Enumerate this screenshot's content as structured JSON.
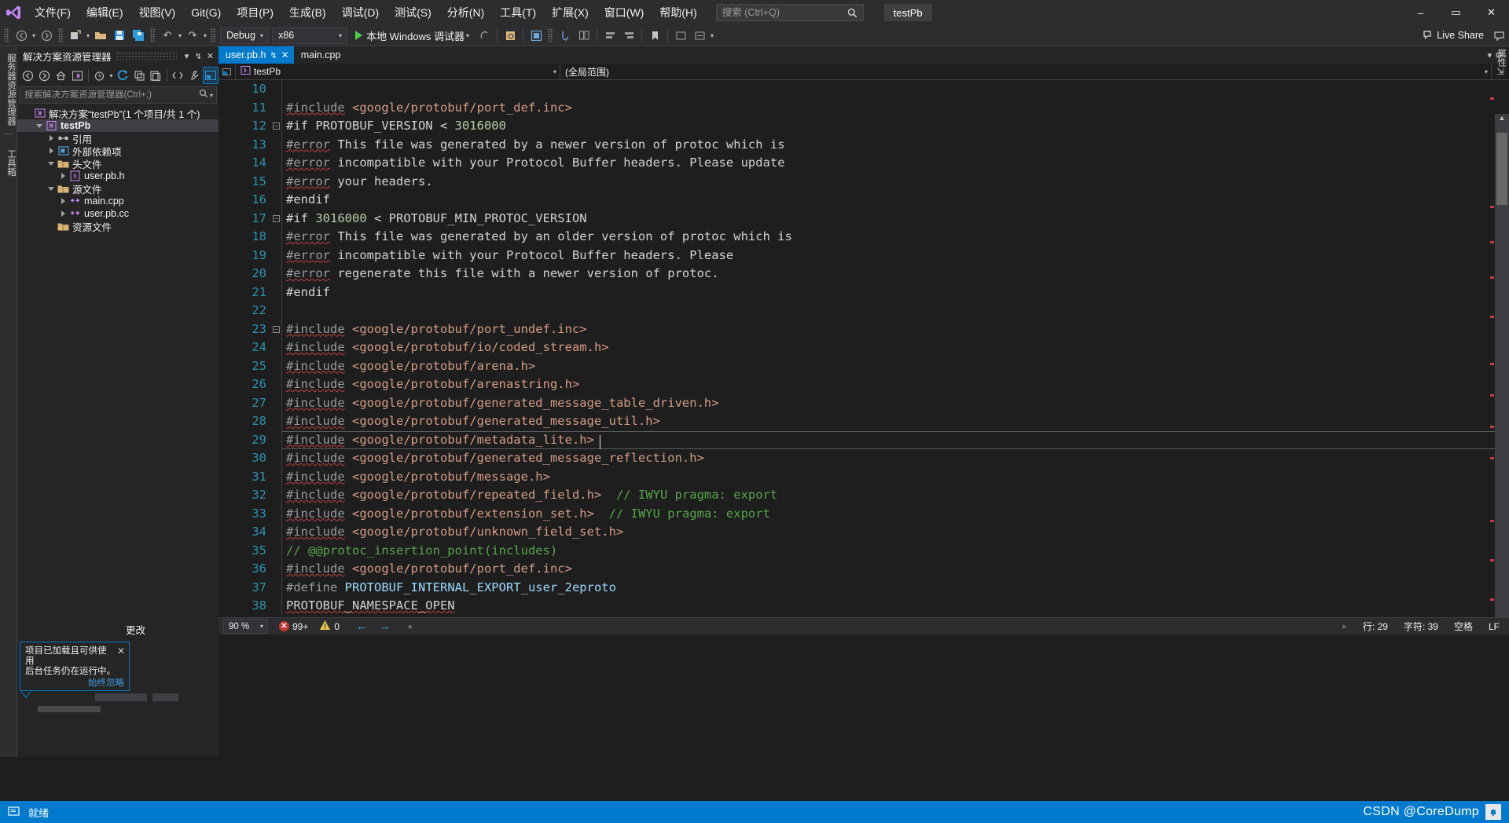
{
  "window": {
    "title": "testPb",
    "minimize": "–",
    "maximize": "▭",
    "close": "✕"
  },
  "menu": {
    "logo": "vs-logo-icon",
    "items": [
      {
        "label": "文件(F)"
      },
      {
        "label": "编辑(E)"
      },
      {
        "label": "视图(V)"
      },
      {
        "label": "Git(G)"
      },
      {
        "label": "项目(P)"
      },
      {
        "label": "生成(B)"
      },
      {
        "label": "调试(D)"
      },
      {
        "label": "测试(S)"
      },
      {
        "label": "分析(N)"
      },
      {
        "label": "工具(T)"
      },
      {
        "label": "扩展(X)"
      },
      {
        "label": "窗口(W)"
      },
      {
        "label": "帮助(H)"
      }
    ]
  },
  "search": {
    "placeholder": "搜索 (Ctrl+Q)",
    "value": ""
  },
  "toolbar": {
    "back_icon": "←",
    "forward_icon": "→",
    "new_project_icon": "new-project-icon",
    "open_icon": "open-folder-icon",
    "save_icon": "save-icon",
    "save_all_icon": "save-all-icon",
    "undo_icon": "↶",
    "redo_icon": "↷",
    "config": "Debug",
    "platform": "x86",
    "run_label": "本地 Windows 调试器",
    "caret": "▾",
    "live_share": "Live Share"
  },
  "vdock": {
    "server_explorer": "服务器资源管理器",
    "toolbox": "工具箱",
    "properties": "属性"
  },
  "solution_explorer": {
    "title": "解决方案资源管理器",
    "dropdown_icon": "▾",
    "pin_icon": "↯",
    "close_icon": "✕",
    "toolbar": [
      {
        "name": "back-icon",
        "glyph": "←"
      },
      {
        "name": "forward-icon",
        "glyph": "→"
      },
      {
        "name": "home-icon",
        "glyph": "⌂"
      },
      {
        "name": "solution-icon",
        "glyph": "▣"
      },
      {
        "name": "pending-changes-icon",
        "glyph": "◔"
      },
      {
        "name": "refresh-icon",
        "glyph": "⟳"
      },
      {
        "name": "collapse-all-icon",
        "glyph": "❐"
      },
      {
        "name": "properties-window-icon",
        "glyph": "☰"
      },
      {
        "name": "show-all-files-icon",
        "glyph": "<>"
      },
      {
        "name": "view-code-icon",
        "glyph": "🔧"
      },
      {
        "name": "preview-selected-icon",
        "glyph": "▤"
      }
    ],
    "search_placeholder": "搜索解决方案资源管理器(Ctrl+;)",
    "tree": [
      {
        "label": "解决方案“testPb”(1 个项目/共 1 个)",
        "depth": 0,
        "expander": "none",
        "icon": "solution-icon",
        "icon_color": "#c586f0",
        "selected": false,
        "bold": false
      },
      {
        "label": "testPb",
        "depth": 1,
        "expander": "down",
        "icon": "project-icon",
        "icon_color": "#c586f0",
        "selected": true,
        "bold": true
      },
      {
        "label": "引用",
        "depth": 2,
        "expander": "right",
        "icon": "references-icon",
        "icon_color": "#c8c8c8",
        "selected": false,
        "bold": false
      },
      {
        "label": "外部依赖项",
        "depth": 2,
        "expander": "right",
        "icon": "external-deps-icon",
        "icon_color": "#4ea1d3",
        "selected": false,
        "bold": false
      },
      {
        "label": "头文件",
        "depth": 2,
        "expander": "down",
        "icon": "folder-icon",
        "icon_color": "#dcb67a",
        "selected": false,
        "bold": false
      },
      {
        "label": "user.pb.h",
        "depth": 3,
        "expander": "right",
        "icon": "header-file-icon",
        "icon_color": "#c586f0",
        "selected": false,
        "bold": false
      },
      {
        "label": "源文件",
        "depth": 2,
        "expander": "down",
        "icon": "folder-icon",
        "icon_color": "#dcb67a",
        "selected": false,
        "bold": false
      },
      {
        "label": "main.cpp",
        "depth": 3,
        "expander": "right",
        "icon": "cpp-file-icon",
        "icon_color": "#c586f0",
        "selected": false,
        "bold": false
      },
      {
        "label": "user.pb.cc",
        "depth": 3,
        "expander": "right",
        "icon": "cpp-file-icon",
        "icon_color": "#c586f0",
        "selected": false,
        "bold": false
      },
      {
        "label": "资源文件",
        "depth": 2,
        "expander": "none",
        "icon": "folder-icon",
        "icon_color": "#dcb67a",
        "selected": false,
        "bold": false
      }
    ]
  },
  "notification": {
    "title": "项目已加载且可供使用",
    "subtitle": "后台任务仍在运行中。",
    "link": "始终忽略",
    "close": "✕",
    "side_text": "更改"
  },
  "editor": {
    "tabs": [
      {
        "label": "user.pb.h",
        "active": true,
        "pin": "↯",
        "close": "✕"
      },
      {
        "label": "main.cpp",
        "active": false,
        "pin": "",
        "close": ""
      }
    ],
    "tabstrip_right": {
      "dropdown": "▾",
      "settings": "⚙"
    },
    "navbar": {
      "project": "testPb",
      "scope": "(全局范围)",
      "caret": "▾",
      "split_icon": "split-view-icon",
      "maximize_icon": "⇲"
    },
    "status": {
      "zoom": "90 %",
      "zoom_caret": "▾",
      "errors": "99+",
      "warnings": "0",
      "prev_icon": "←",
      "next_icon": "→",
      "line_label": "行: 29",
      "char_label": "字符: 39",
      "indent": "空格",
      "eol": "LF"
    },
    "code_lines": [
      {
        "num": 10,
        "fold": "",
        "tokens": []
      },
      {
        "num": 11,
        "fold": "",
        "tokens": [
          {
            "t": "#include",
            "c": "k-pp",
            "squig": true
          },
          {
            "t": " ",
            "c": "k-txt"
          },
          {
            "t": "<google/protobuf/port_def.inc>",
            "c": "k-str"
          }
        ]
      },
      {
        "num": 12,
        "fold": "minus",
        "tokens": [
          {
            "t": "#if",
            "c": "k-dir"
          },
          {
            "t": " PROTOBUF_VERSION < ",
            "c": "k-txt"
          },
          {
            "t": "3016000",
            "c": "k-num"
          }
        ]
      },
      {
        "num": 13,
        "fold": "",
        "tokens": [
          {
            "t": "#error",
            "c": "k-pp",
            "squig": true
          },
          {
            "t": " This file was generated by a newer version of protoc which is",
            "c": "k-txt"
          }
        ]
      },
      {
        "num": 14,
        "fold": "",
        "tokens": [
          {
            "t": "#error",
            "c": "k-pp",
            "squig": true
          },
          {
            "t": " incompatible with your Protocol Buffer headers. Please update",
            "c": "k-txt"
          }
        ]
      },
      {
        "num": 15,
        "fold": "",
        "tokens": [
          {
            "t": "#error",
            "c": "k-pp",
            "squig": true
          },
          {
            "t": " your headers.",
            "c": "k-txt"
          }
        ]
      },
      {
        "num": 16,
        "fold": "",
        "tokens": [
          {
            "t": "#endif",
            "c": "k-dir"
          }
        ]
      },
      {
        "num": 17,
        "fold": "minus",
        "tokens": [
          {
            "t": "#if",
            "c": "k-dir"
          },
          {
            "t": " ",
            "c": "k-txt"
          },
          {
            "t": "3016000",
            "c": "k-num"
          },
          {
            "t": " < PROTOBUF_MIN_PROTOC_VERSION",
            "c": "k-txt"
          }
        ]
      },
      {
        "num": 18,
        "fold": "",
        "tokens": [
          {
            "t": "#error",
            "c": "k-pp",
            "squig": true
          },
          {
            "t": " This file was generated by an older version of protoc which is",
            "c": "k-txt"
          }
        ]
      },
      {
        "num": 19,
        "fold": "",
        "tokens": [
          {
            "t": "#error",
            "c": "k-pp",
            "squig": true
          },
          {
            "t": " incompatible with your Protocol Buffer headers. Please",
            "c": "k-txt"
          }
        ]
      },
      {
        "num": 20,
        "fold": "",
        "tokens": [
          {
            "t": "#error",
            "c": "k-pp",
            "squig": true
          },
          {
            "t": " regenerate this file with a newer version of protoc.",
            "c": "k-txt"
          }
        ]
      },
      {
        "num": 21,
        "fold": "",
        "tokens": [
          {
            "t": "#endif",
            "c": "k-dir"
          }
        ]
      },
      {
        "num": 22,
        "fold": "",
        "tokens": []
      },
      {
        "num": 23,
        "fold": "minus",
        "tokens": [
          {
            "t": "#include",
            "c": "k-pp",
            "squig": true
          },
          {
            "t": " ",
            "c": "k-txt"
          },
          {
            "t": "<google/protobuf/port_undef.inc>",
            "c": "k-str"
          }
        ]
      },
      {
        "num": 24,
        "fold": "",
        "tokens": [
          {
            "t": "#include",
            "c": "k-pp",
            "squig": true
          },
          {
            "t": " ",
            "c": "k-txt"
          },
          {
            "t": "<google/protobuf/io/coded_stream.h>",
            "c": "k-str"
          }
        ]
      },
      {
        "num": 25,
        "fold": "",
        "tokens": [
          {
            "t": "#include",
            "c": "k-pp",
            "squig": true
          },
          {
            "t": " ",
            "c": "k-txt"
          },
          {
            "t": "<google/protobuf/arena.h>",
            "c": "k-str"
          }
        ]
      },
      {
        "num": 26,
        "fold": "",
        "tokens": [
          {
            "t": "#include",
            "c": "k-pp",
            "squig": true
          },
          {
            "t": " ",
            "c": "k-txt"
          },
          {
            "t": "<google/protobuf/arenastring.h>",
            "c": "k-str"
          }
        ]
      },
      {
        "num": 27,
        "fold": "",
        "tokens": [
          {
            "t": "#include",
            "c": "k-pp",
            "squig": true
          },
          {
            "t": " ",
            "c": "k-txt"
          },
          {
            "t": "<google/protobuf/generated_message_table_driven.h>",
            "c": "k-str"
          }
        ]
      },
      {
        "num": 28,
        "fold": "",
        "tokens": [
          {
            "t": "#include",
            "c": "k-pp",
            "squig": true
          },
          {
            "t": " ",
            "c": "k-txt"
          },
          {
            "t": "<google/protobuf/generated_message_util.h>",
            "c": "k-str"
          }
        ]
      },
      {
        "num": 29,
        "fold": "",
        "current": true,
        "tokens": [
          {
            "t": "#include",
            "c": "k-pp",
            "squig": true
          },
          {
            "t": " ",
            "c": "k-txt"
          },
          {
            "t": "<google/protobuf/metadata_lite.h>",
            "c": "k-str"
          }
        ]
      },
      {
        "num": 30,
        "fold": "",
        "tokens": [
          {
            "t": "#include",
            "c": "k-pp",
            "squig": true
          },
          {
            "t": " ",
            "c": "k-txt"
          },
          {
            "t": "<google/protobuf/generated_message_reflection.h>",
            "c": "k-str"
          }
        ]
      },
      {
        "num": 31,
        "fold": "",
        "tokens": [
          {
            "t": "#include",
            "c": "k-pp",
            "squig": true
          },
          {
            "t": " ",
            "c": "k-txt"
          },
          {
            "t": "<google/protobuf/message.h>",
            "c": "k-str"
          }
        ]
      },
      {
        "num": 32,
        "fold": "",
        "tokens": [
          {
            "t": "#include",
            "c": "k-pp",
            "squig": true
          },
          {
            "t": " ",
            "c": "k-txt"
          },
          {
            "t": "<google/protobuf/repeated_field.h>",
            "c": "k-str"
          },
          {
            "t": "  ",
            "c": "k-txt"
          },
          {
            "t": "// IWYU pragma: export",
            "c": "k-com"
          }
        ]
      },
      {
        "num": 33,
        "fold": "",
        "tokens": [
          {
            "t": "#include",
            "c": "k-pp",
            "squig": true
          },
          {
            "t": " ",
            "c": "k-txt"
          },
          {
            "t": "<google/protobuf/extension_set.h>",
            "c": "k-str"
          },
          {
            "t": "  ",
            "c": "k-txt"
          },
          {
            "t": "// IWYU pragma: export",
            "c": "k-com"
          }
        ]
      },
      {
        "num": 34,
        "fold": "",
        "tokens": [
          {
            "t": "#include",
            "c": "k-pp",
            "squig": true
          },
          {
            "t": " ",
            "c": "k-txt"
          },
          {
            "t": "<google/protobuf/unknown_field_set.h>",
            "c": "k-str"
          }
        ]
      },
      {
        "num": 35,
        "fold": "",
        "tokens": [
          {
            "t": "// @@protoc_insertion_point(includes)",
            "c": "k-com"
          }
        ]
      },
      {
        "num": 36,
        "fold": "",
        "tokens": [
          {
            "t": "#include",
            "c": "k-pp",
            "squig": true
          },
          {
            "t": " ",
            "c": "k-txt"
          },
          {
            "t": "<google/protobuf/port_def.inc>",
            "c": "k-str"
          }
        ]
      },
      {
        "num": 37,
        "fold": "",
        "tokens": [
          {
            "t": "#define",
            "c": "k-pp"
          },
          {
            "t": " ",
            "c": "k-txt"
          },
          {
            "t": "PROTOBUF_INTERNAL_EXPORT_user_2eproto",
            "c": "k-mac"
          }
        ]
      },
      {
        "num": 38,
        "fold": "",
        "tokens": [
          {
            "t": "PROTOBUF_NAMESPACE_OPEN",
            "c": "k-txt",
            "squig": true
          }
        ]
      }
    ]
  },
  "statusbar": {
    "icon": "source-control-icon",
    "text": "就绪",
    "watermark": "CSDN @CoreDump",
    "bell": "🔔"
  }
}
